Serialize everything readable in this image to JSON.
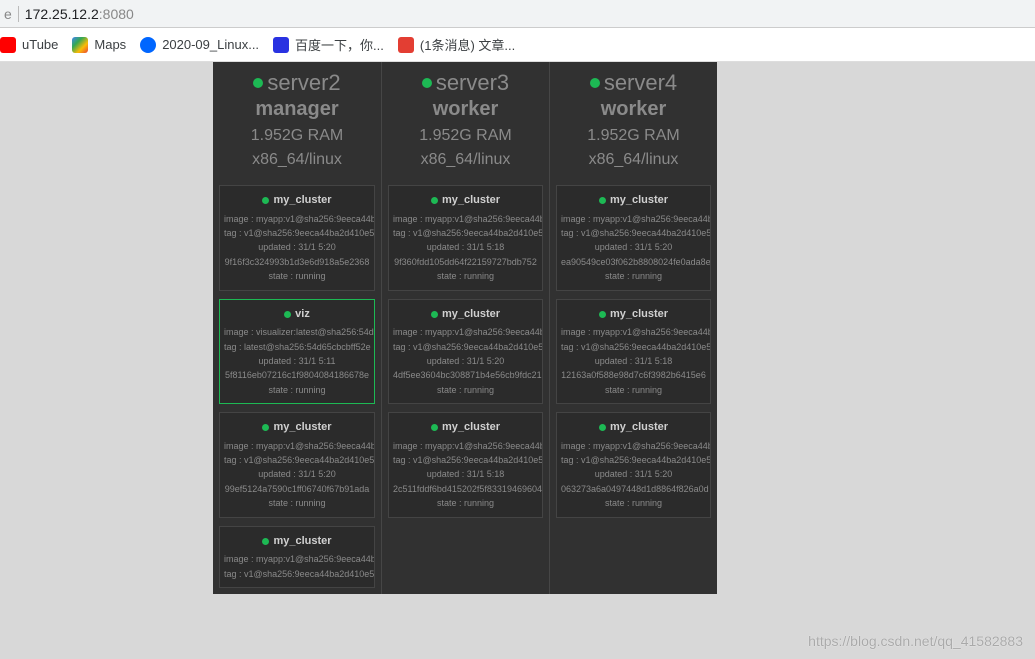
{
  "url": {
    "prefix_trunc": "e",
    "host": "172.25.12.2",
    "port": ":8080"
  },
  "bookmarks": [
    {
      "name": "uTube",
      "iconClass": "yt-icon"
    },
    {
      "name": "Maps",
      "iconClass": "maps-icon"
    },
    {
      "name": "2020-09_Linux...",
      "iconClass": "linux-icon"
    },
    {
      "name": "百度一下，你...",
      "iconClass": "baidu-icon"
    },
    {
      "name": "(1条消息) 文章...",
      "iconClass": "csdn-icon"
    }
  ],
  "nodes": [
    {
      "name": "server2",
      "role": "manager",
      "ram": "1.952G RAM",
      "arch": "x86_64/linux",
      "cards": [
        {
          "title": "my_cluster",
          "highlight": false,
          "lines": [
            "image : myapp:v1@sha256:9eeca44b",
            "tag : v1@sha256:9eeca44ba2d410e5",
            "updated : 31/1 5:20",
            "9f16f3c324993b1d3e6d918a5e2368",
            "state : running"
          ]
        },
        {
          "title": "viz",
          "highlight": true,
          "lines": [
            "image : visualizer:latest@sha256:54d",
            "tag : latest@sha256:54d65cbcbff52e",
            "updated : 31/1 5:11",
            "5f8116eb07216c1f9804084186678e",
            "state : running"
          ]
        },
        {
          "title": "my_cluster",
          "highlight": false,
          "lines": [
            "image : myapp:v1@sha256:9eeca44b",
            "tag : v1@sha256:9eeca44ba2d410e5",
            "updated : 31/1 5:20",
            "99ef5124a7590c1ff06740f67b91ada",
            "state : running"
          ]
        },
        {
          "title": "my_cluster",
          "highlight": false,
          "lines": [
            "image : myapp:v1@sha256:9eeca44b",
            "tag : v1@sha256:9eeca44ba2d410e5"
          ]
        }
      ]
    },
    {
      "name": "server3",
      "role": "worker",
      "ram": "1.952G RAM",
      "arch": "x86_64/linux",
      "cards": [
        {
          "title": "my_cluster",
          "highlight": false,
          "lines": [
            "image : myapp:v1@sha256:9eeca44b",
            "tag : v1@sha256:9eeca44ba2d410e5",
            "updated : 31/1 5:18",
            "9f360fdd105dd64f22159727bdb752",
            "state : running"
          ]
        },
        {
          "title": "my_cluster",
          "highlight": false,
          "lines": [
            "image : myapp:v1@sha256:9eeca44b",
            "tag : v1@sha256:9eeca44ba2d410e5",
            "updated : 31/1 5:20",
            "4df5ee3604bc308871b4e56cb9fdc21",
            "state : running"
          ]
        },
        {
          "title": "my_cluster",
          "highlight": false,
          "lines": [
            "image : myapp:v1@sha256:9eeca44b",
            "tag : v1@sha256:9eeca44ba2d410e5",
            "updated : 31/1 5:18",
            "2c511fddf6bd415202f5f83319469604",
            "state : running"
          ]
        }
      ]
    },
    {
      "name": "server4",
      "role": "worker",
      "ram": "1.952G RAM",
      "arch": "x86_64/linux",
      "cards": [
        {
          "title": "my_cluster",
          "highlight": false,
          "lines": [
            "image : myapp:v1@sha256:9eeca44b",
            "tag : v1@sha256:9eeca44ba2d410e5",
            "updated : 31/1 5:20",
            "ea90549ce03f062b8808024fe0ada8e",
            "state : running"
          ]
        },
        {
          "title": "my_cluster",
          "highlight": false,
          "lines": [
            "image : myapp:v1@sha256:9eeca44b",
            "tag : v1@sha256:9eeca44ba2d410e5",
            "updated : 31/1 5:18",
            "12163a0f588e98d7c6f3982b6415e6",
            "state : running"
          ]
        },
        {
          "title": "my_cluster",
          "highlight": false,
          "lines": [
            "image : myapp:v1@sha256:9eeca44b",
            "tag : v1@sha256:9eeca44ba2d410e5",
            "updated : 31/1 5:20",
            "063273a6a0497448d1d8864f826a0d",
            "state : running"
          ]
        }
      ]
    }
  ],
  "watermark": "https://blog.csdn.net/qq_41582883"
}
